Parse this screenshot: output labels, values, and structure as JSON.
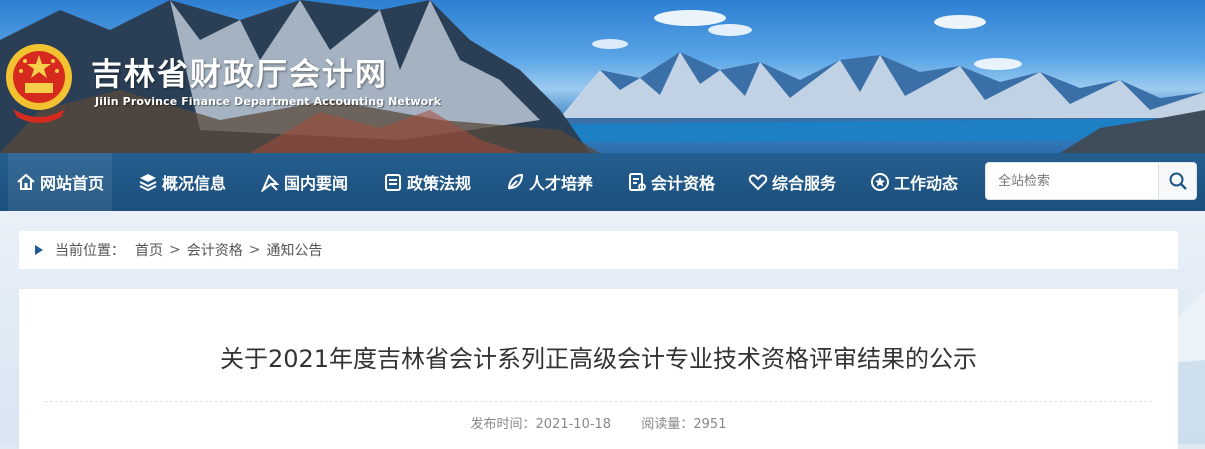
{
  "header": {
    "site_title": "吉林省财政厅会计网",
    "site_subtitle": "Jilin Province Finance Department Accounting Network"
  },
  "nav": {
    "items": [
      {
        "label": "网站首页",
        "icon": "home-icon"
      },
      {
        "label": "概况信息",
        "icon": "layers-icon"
      },
      {
        "label": "国内要闻",
        "icon": "flag-icon"
      },
      {
        "label": "政策法规",
        "icon": "document-icon"
      },
      {
        "label": "人才培养",
        "icon": "leaf-icon"
      },
      {
        "label": "会计资格",
        "icon": "certificate-icon"
      },
      {
        "label": "综合服务",
        "icon": "heart-icon"
      },
      {
        "label": "工作动态",
        "icon": "star-badge-icon"
      }
    ],
    "search_placeholder": "全站检索"
  },
  "breadcrumb": {
    "label": "当前位置：",
    "items": [
      "首页",
      "会计资格",
      "通知公告"
    ],
    "separator": ">"
  },
  "article": {
    "title": "关于2021年度吉林省会计系列正高级会计专业技术资格评审结果的公示",
    "publish_label": "发布时间：",
    "publish_date": "2021-10-18",
    "views_label": "阅读量：",
    "views": "2951"
  },
  "colors": {
    "nav_bg": "#1f5584",
    "accent_blue": "#2b6fae",
    "breadcrumb_arrow": "#1f5a96"
  }
}
